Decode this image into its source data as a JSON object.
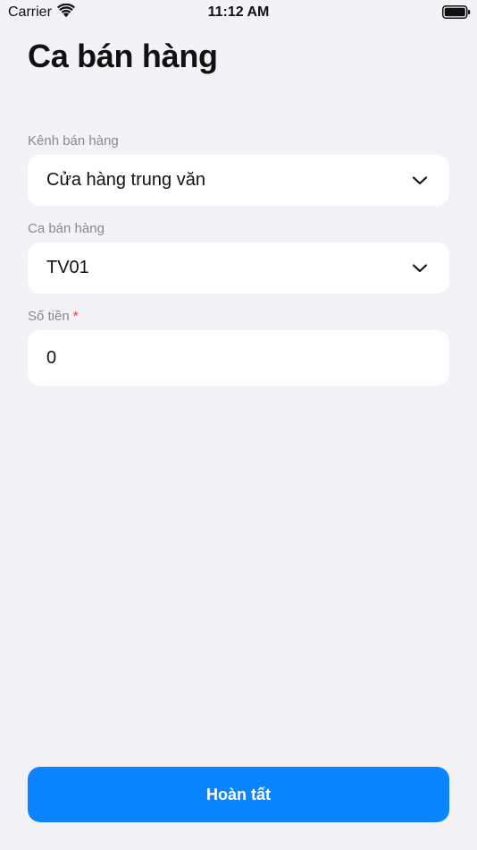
{
  "status_bar": {
    "carrier": "Carrier",
    "time": "11:12 AM"
  },
  "page": {
    "title": "Ca bán hàng"
  },
  "form": {
    "channel": {
      "label": "Kênh bán hàng",
      "value": "Cửa hàng trung văn"
    },
    "shift": {
      "label": "Ca bán hàng",
      "value": "TV01"
    },
    "amount": {
      "label": "Số tiền",
      "required_mark": "*",
      "value": "0"
    }
  },
  "actions": {
    "submit_label": "Hoàn tất"
  },
  "colors": {
    "background": "#f2f2f7",
    "accent": "#0a84ff",
    "required": "#ff3b30",
    "label": "#8a8a8e"
  },
  "icons": [
    "wifi-icon",
    "battery-icon",
    "chevron-down-icon"
  ]
}
